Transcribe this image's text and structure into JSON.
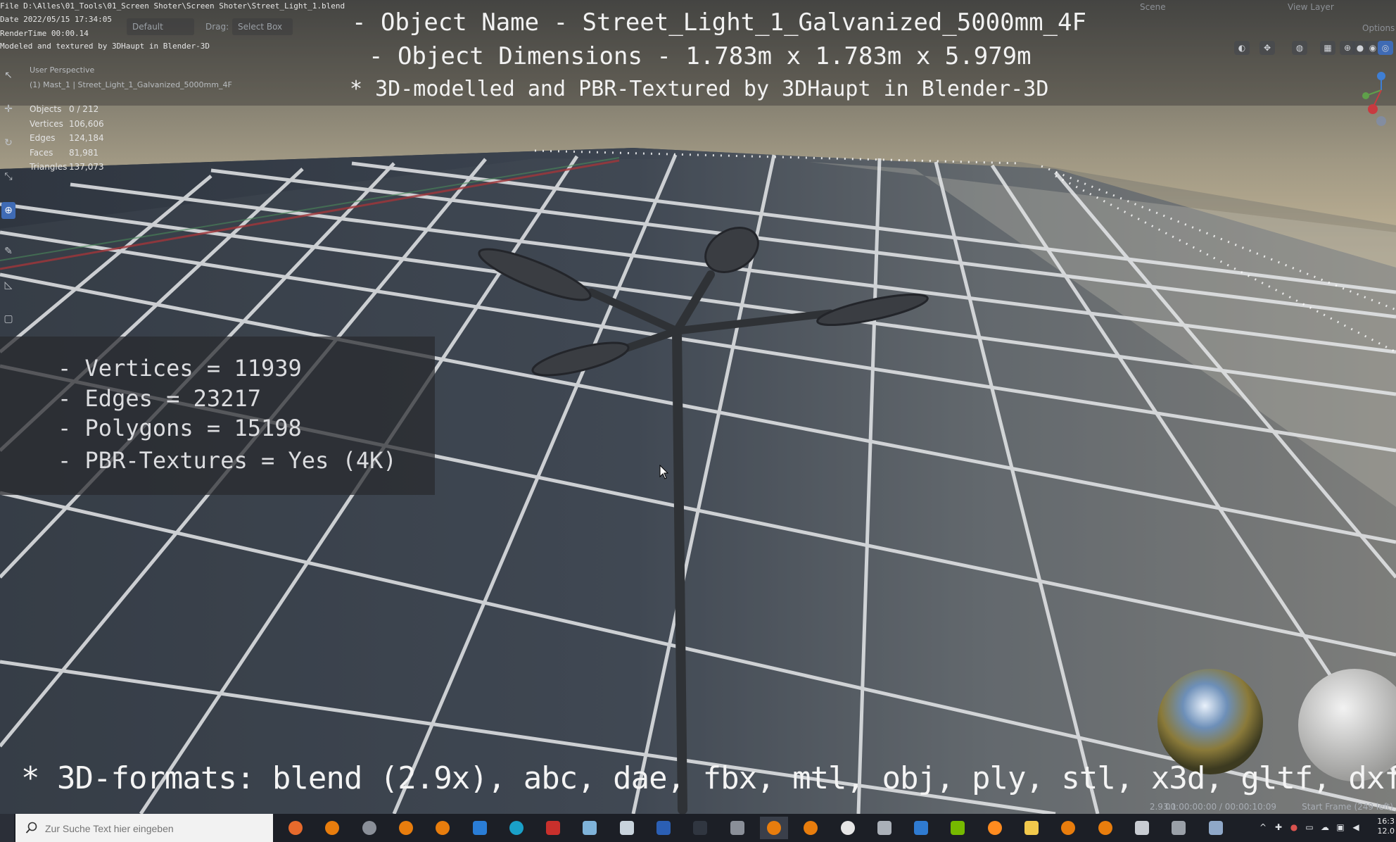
{
  "stamp": {
    "file": "File D:\\Alles\\01_Tools\\01_Screen Shoter\\Screen Shoter\\Street_Light_1.blend",
    "date": "Date 2022/05/15 17:34:05",
    "render_time": "RenderTime 00:00.14",
    "modeled_by": "Modeled and textured by 3DHaupt in Blender-3D"
  },
  "banner": {
    "object_name": "- Object Name - Street_Light_1_Galvanized_5000mm_4F",
    "dimensions": "- Object Dimensions -  1.783m x 1.783m x 5.979m",
    "credit": "* 3D-modelled and PBR-Textured by 3DHaupt in Blender-3D"
  },
  "header": {
    "orientation": "Default",
    "drag_label": "Drag:",
    "select_mode": "Select Box"
  },
  "top_right": {
    "scene": "Scene",
    "view_layer": "View Layer",
    "options": "Options"
  },
  "viewport": {
    "perspective": "User Perspective",
    "active_object": "(1) Mast_1 | Street_Light_1_Galvanized_5000mm_4F"
  },
  "stats": [
    {
      "label": "Objects",
      "value": "0 / 212"
    },
    {
      "label": "Vertices",
      "value": "106,606"
    },
    {
      "label": "Edges",
      "value": "124,184"
    },
    {
      "label": "Faces",
      "value": "81,981"
    },
    {
      "label": "Triangles",
      "value": "137,073"
    }
  ],
  "mesh_info": {
    "vertices": "- Vertices = 11939",
    "edges": "- Edges = 23217",
    "polygons": "- Polygons = 15198",
    "textures": "- PBR-Textures =  Yes (4K)"
  },
  "formats": "* 3D-formats: blend (2.9x), abc, dae, fbx, mtl, obj, ply, stl, x3d, gltf, dxf",
  "status_bar": {
    "version": "2.93.1",
    "timecode": "00:00:00:00 / 00:00:10:09",
    "start_frame": "Start Frame (249 left)"
  },
  "taskbar": {
    "search_placeholder": "Zur Suche Text hier eingeben",
    "clock_time": "16:3",
    "clock_date": "12.0",
    "apps": [
      "firefox-icon",
      "blender-icon",
      "steam-icon",
      "blender-icon",
      "blender-icon",
      "mail-icon",
      "edge-icon",
      "bug-icon",
      "notes-icon",
      "paint-icon",
      "word-icon",
      "terminal-icon",
      "capture-icon",
      "blender-icon",
      "blender-icon",
      "panda-icon",
      "box-icon",
      "calendar-icon",
      "nvidia-icon",
      "media-icon",
      "folder-icon",
      "blender-icon",
      "blender-icon",
      "settings-icon",
      "server-icon",
      "window-icon"
    ]
  },
  "colors": {
    "accent_blue": "#3f6bb5",
    "taskbar": "#1c1f26",
    "grid_line": "#e6e8ea"
  }
}
